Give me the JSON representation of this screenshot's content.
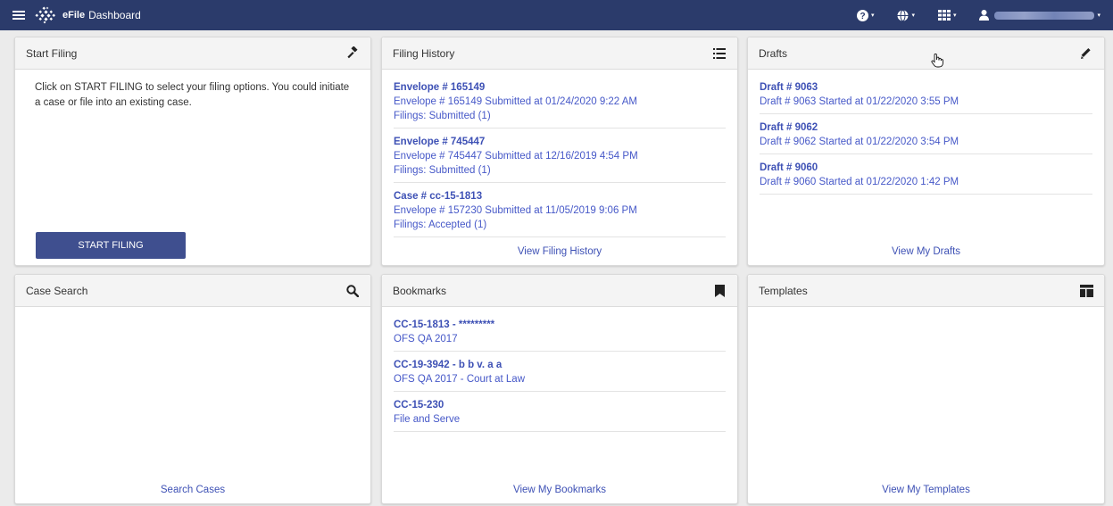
{
  "topbar": {
    "brand_strong": "eFile",
    "brand_title": "Dashboard",
    "help_icon": "help-circle-icon",
    "globe_icon": "globe-icon",
    "apps_icon": "grid-icon",
    "user_icon": "user-icon",
    "caret": "▾",
    "bg_color": "#2b3b6b"
  },
  "start_filing": {
    "title": "Start Filing",
    "icon": "gavel-icon",
    "text": "Click on START FILING to select your filing options. You could initiate a case or file into an existing case.",
    "button_label": "START FILING",
    "button_color": "#3f4f8f"
  },
  "filing_history": {
    "title": "Filing History",
    "icon": "list-icon",
    "entries": [
      {
        "title": "Envelope # 165149",
        "line1": "Envelope # 165149 Submitted at 01/24/2020 9:22 AM",
        "line2": "Filings: Submitted (1)"
      },
      {
        "title": "Envelope # 745447",
        "line1": "Envelope # 745447 Submitted at 12/16/2019 4:54 PM",
        "line2": "Filings: Submitted (1)"
      },
      {
        "title": "Case # cc-15-1813",
        "line1": "Envelope # 157230 Submitted at 11/05/2019 9:06 PM",
        "line2": "Filings: Accepted (1)"
      }
    ],
    "footer": "View Filing History"
  },
  "drafts": {
    "title": "Drafts",
    "icon": "pencil-icon",
    "entries": [
      {
        "title": "Draft # 9063",
        "line1": "Draft # 9063 Started at 01/22/2020 3:55 PM"
      },
      {
        "title": "Draft # 9062",
        "line1": "Draft # 9062 Started at 01/22/2020 3:54 PM"
      },
      {
        "title": "Draft # 9060",
        "line1": "Draft # 9060 Started at 01/22/2020 1:42 PM"
      }
    ],
    "footer": "View My Drafts"
  },
  "case_search": {
    "title": "Case Search",
    "icon": "search-icon",
    "footer": "Search Cases"
  },
  "bookmarks": {
    "title": "Bookmarks",
    "icon": "bookmark-icon",
    "entries": [
      {
        "title": "CC-15-1813 - *********",
        "line1": "OFS QA 2017"
      },
      {
        "title": "CC-19-3942 - b b v. a a",
        "line1": "OFS QA 2017 - Court at Law"
      },
      {
        "title": "CC-15-230",
        "line1": "File and Serve"
      }
    ],
    "footer": "View My Bookmarks"
  },
  "templates": {
    "title": "Templates",
    "icon": "template-icon",
    "footer": "View My Templates"
  },
  "colors": {
    "link": "#3e51b5",
    "page_bg": "#ebebeb"
  }
}
